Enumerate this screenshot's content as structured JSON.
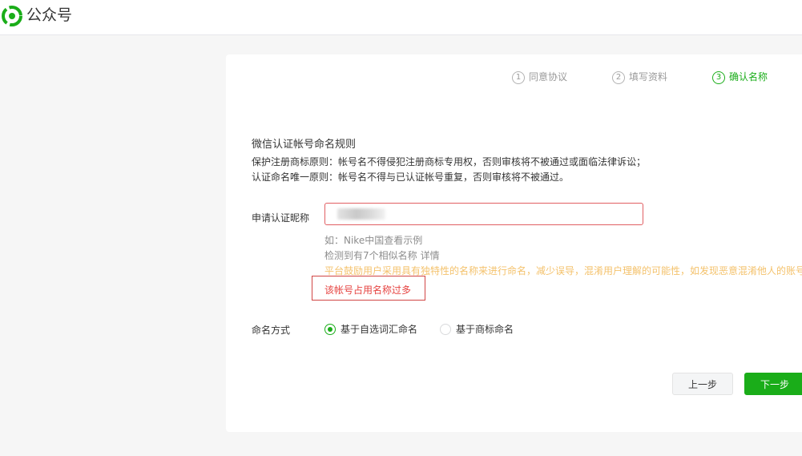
{
  "header": {
    "app_name": "公众号",
    "logo_icon": "wechat-mp-logo-icon"
  },
  "steps": [
    {
      "num": "1",
      "label": "同意协议",
      "active": false
    },
    {
      "num": "2",
      "label": "填写资料",
      "active": false
    },
    {
      "num": "3",
      "label": "确认名称",
      "active": true
    }
  ],
  "rules": {
    "title": "微信认证帐号命名规则",
    "items": [
      "保护注册商标原则：帐号名不得侵犯注册商标专用权，否则审核将不被通过或面临法律诉讼；",
      "认证命名唯一原则：帐号名不得与已认证帐号重复，否则审核将不被通过。"
    ]
  },
  "form": {
    "nickname_label": "申请认证昵称",
    "nickname_value": "",
    "example_tip": "如：Nike中国查看示例",
    "similar_tip": "检测到有7个相似名称",
    "similar_detail": "详情",
    "warning": "平台鼓励用户采用具有独特性的名称来进行命名，减少误导，混淆用户理解的可能性，如发现恶意混淆他人的账号",
    "error": "该帐号占用名称过多",
    "naming_label": "命名方式",
    "naming_options": [
      {
        "label": "基于自选词汇命名",
        "checked": true
      },
      {
        "label": "基于商标命名",
        "checked": false
      }
    ]
  },
  "buttons": {
    "prev": "上一步",
    "next": "下一步"
  },
  "colors": {
    "accent": "#1aad19",
    "error": "#e64340",
    "warning": "#f4c26c"
  }
}
